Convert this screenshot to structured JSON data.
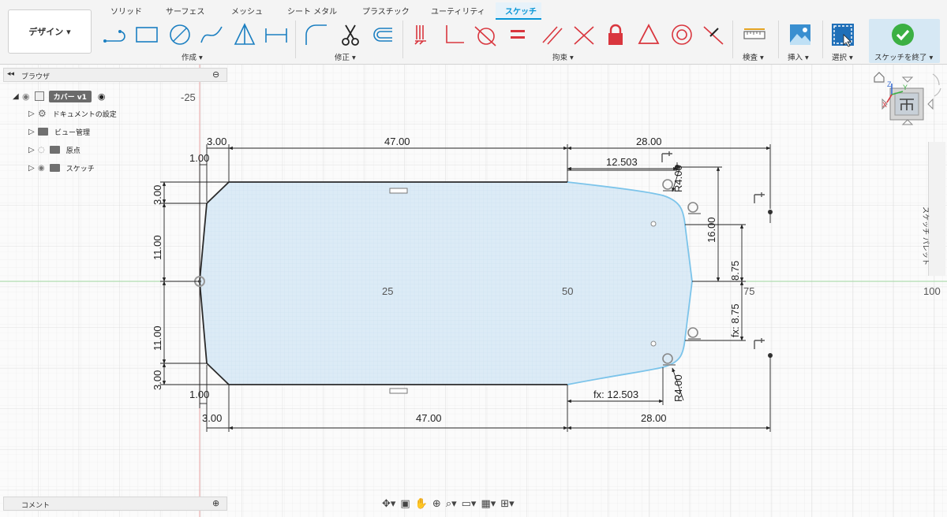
{
  "workspace": {
    "label": "デザイン ▾"
  },
  "tabs": [
    "ソリッド",
    "サーフェス",
    "メッシュ",
    "シート メタル",
    "プラスチック",
    "ユーティリティ",
    "スケッチ"
  ],
  "groups": {
    "create": "作成 ▾",
    "modify": "修正 ▾",
    "constraints": "拘束 ▾",
    "inspect": "検査 ▾",
    "insert": "挿入 ▾",
    "select": "選択 ▾",
    "finish": "スケッチを終了 ▾"
  },
  "browser": {
    "title": "ブラウザ",
    "root": "カバー v1",
    "items": [
      "ドキュメントの設定",
      "ビュー管理",
      "原点",
      "スケッチ"
    ]
  },
  "comments": {
    "label": "コメント"
  },
  "sidebar": {
    "palette_label": "スケッチ パレット"
  },
  "axis_labels": {
    "neg25": "-25",
    "x25": "25",
    "x50": "50",
    "x75": "75",
    "x100": "100"
  },
  "dimensions": {
    "top_3": "3.00",
    "top_1": "1.00",
    "top_47": "47.00",
    "top_28": "28.00",
    "top_12503": "12.503",
    "left_3_top": "3.00",
    "left_11_top": "11.00",
    "left_11_bot": "11.00",
    "left_3_bot": "3.00",
    "r4_top": "R4.00",
    "r4_bot": "R4.00",
    "right_16": "16.00",
    "right_875": "8.75",
    "right_fx875": "fx: 8.75",
    "bot_1": "1.00",
    "bot_3": "3.00",
    "bot_47": "47.00",
    "bot_28": "28.00",
    "bot_fx12503": "fx: 12.503"
  },
  "colors": {
    "accent": "#0696d7",
    "profile_fill": "#dcebf6",
    "profile_line": "#2b2b2b",
    "spline": "#7cc4ea",
    "x_axis": "#9ed69e",
    "y_axis": "#e7a3a3",
    "finish_check": "#3cb043",
    "constraint_red": "#d9363e"
  }
}
